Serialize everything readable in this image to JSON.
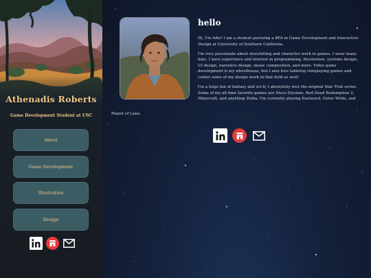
{
  "sidebar": {
    "name": "Athenadis Roberts",
    "subtitle": "Game Development Student at USC",
    "nav": [
      {
        "label": "About"
      },
      {
        "label": "Game Development"
      },
      {
        "label": "Illustration"
      },
      {
        "label": "Design"
      }
    ],
    "social": [
      "linkedin-icon",
      "shop-icon",
      "mail-icon"
    ]
  },
  "main": {
    "heading": "hello",
    "paragraphs": [
      "Hi, I'm Adis! I am a student pursuing a BFA in Game Development and Interactive Design at University of Southern California.",
      "I'm very passionate about storytelling and character work in games. I wear many hats. I have experience and interest in programming, illustration, systems design, UI design, narrative design, music composition, and more. Video game development is my wheelhouse, but I also love tabletop roleplaying games and center some of my design work in that field as well!",
      "I'm a huge fan of fantasy and sci-fi; I absolutely love the original Star Trek series. Some of my all time favorite games are Disco Elysium, Red Dead Redemption 2, Minecraft, and anything Zelda. I'm currently playing Eastward, Outer Wilds, and"
    ],
    "paragraph_tail": "Planet of Lana.",
    "social": [
      "linkedin-icon",
      "shop-icon",
      "mail-icon"
    ]
  },
  "colors": {
    "accent": "#f0c98a",
    "nav_button": "#3b5c63",
    "shop_red": "#e23c3c"
  }
}
